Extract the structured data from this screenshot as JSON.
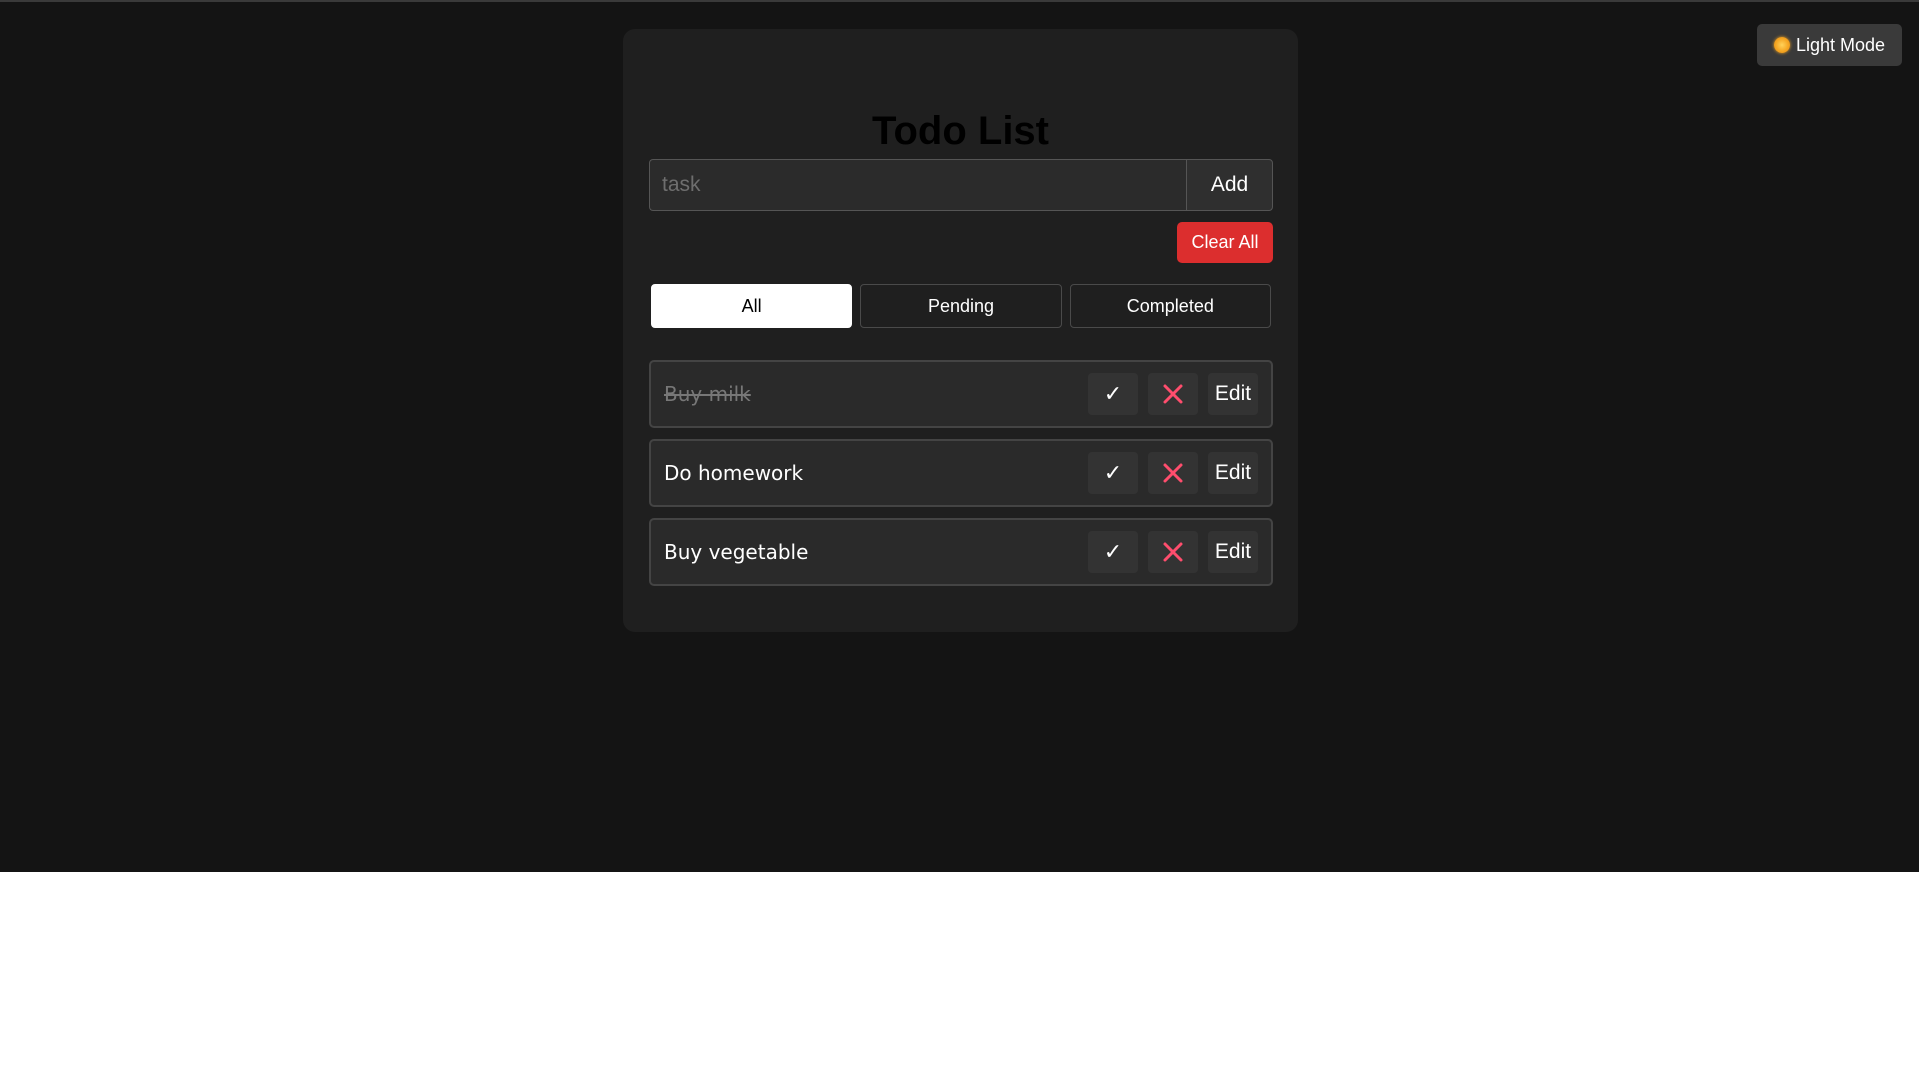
{
  "theme_toggle": {
    "label": "Light Mode",
    "icon": "sun-icon"
  },
  "app": {
    "title": "Todo List"
  },
  "input": {
    "placeholder": "task",
    "value": ""
  },
  "buttons": {
    "add_label": "Add",
    "clear_all_label": "Clear All",
    "edit_label": "Edit"
  },
  "filters": [
    {
      "label": "All",
      "active": true
    },
    {
      "label": "Pending",
      "active": false
    },
    {
      "label": "Completed",
      "active": false
    }
  ],
  "todos": [
    {
      "text": "Buy milk",
      "completed": true
    },
    {
      "text": "Do homework",
      "completed": false
    },
    {
      "text": "Buy vegetable",
      "completed": false
    }
  ],
  "icons": {
    "complete": "check-icon",
    "delete": "close-icon"
  },
  "colors": {
    "background": "#141414",
    "card": "#1f1f1f",
    "danger": "#dc2e2e",
    "delete_icon": "#ff4d6d",
    "active_filter": "#ffffff"
  }
}
